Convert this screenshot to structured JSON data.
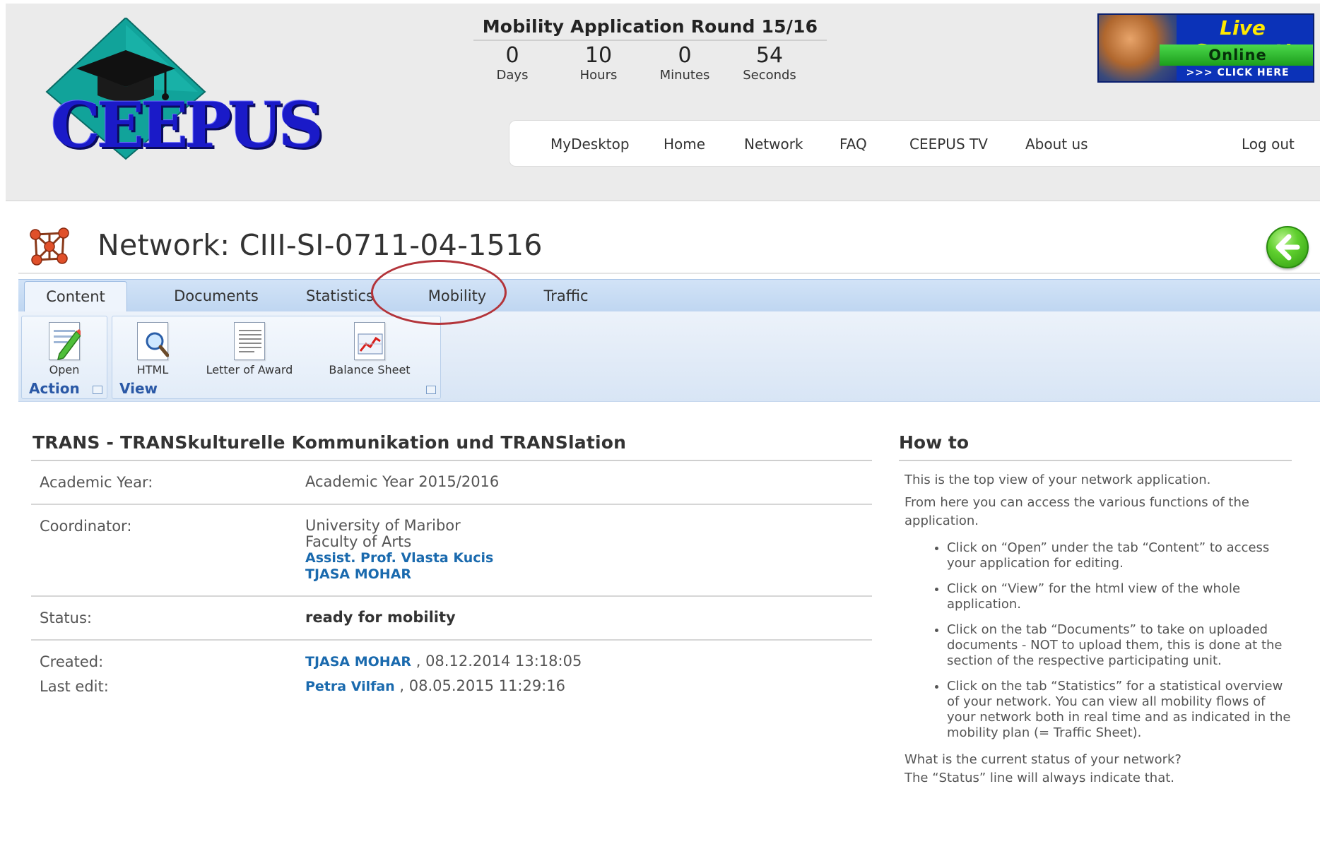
{
  "header": {
    "logo_text": "CEEPUS",
    "countdown": {
      "title": "Mobility Application Round 15/16",
      "units": [
        {
          "value": "0",
          "label": "Days"
        },
        {
          "value": "10",
          "label": "Hours"
        },
        {
          "value": "0",
          "label": "Minutes"
        },
        {
          "value": "54",
          "label": "Seconds"
        }
      ]
    },
    "live_support": {
      "title": "Live Support!",
      "status": "Online",
      "cta": ">>> CLICK HERE"
    },
    "nav": [
      "MyDesktop",
      "Home",
      "Network",
      "FAQ",
      "CEEPUS TV",
      "About us",
      "Log out"
    ]
  },
  "page": {
    "title": "Network: CIII-SI-0711-04-1516"
  },
  "ribbon": {
    "tabs": [
      "Content",
      "Documents",
      "Statistics",
      "Mobility",
      "Traffic"
    ],
    "active_tab": "Content",
    "groups": {
      "action": {
        "label": "Action",
        "buttons": [
          "Open"
        ]
      },
      "view": {
        "label": "View",
        "buttons": [
          "HTML",
          "Letter of Award",
          "Balance Sheet"
        ]
      }
    }
  },
  "details": {
    "heading": "TRANS - TRANSkulturelle Kommunikation und TRANSlation",
    "academic_year": {
      "label": "Academic Year:",
      "value": "Academic Year 2015/2016"
    },
    "coordinator": {
      "label": "Coordinator:",
      "university": "University of Maribor",
      "faculty": "Faculty of Arts",
      "person": "Assist. Prof. Vlasta Kucis",
      "contact": "TJASA MOHAR"
    },
    "status": {
      "label": "Status:",
      "value": "ready for mobility"
    },
    "created": {
      "label": "Created:",
      "user": "TJASA MOHAR",
      "date": " , 08.12.2014 13:18:05"
    },
    "last_edit": {
      "label": "Last edit:",
      "user": "Petra Vilfan",
      "date": " , 08.05.2015 11:29:16"
    }
  },
  "howto": {
    "title": "How to",
    "intro1": "This is the top view of your network application.",
    "intro2": "From here you can access the various functions of the application.",
    "items": [
      "Click on “Open” under the tab “Content” to access your application for editing.",
      "Click on “View” for the html view of the whole application.",
      "Click on the tab “Documents” to take on uploaded documents - NOT to upload them, this is done at the section of the respective participating unit.",
      "Click on the tab “Statistics” for a statistical overview of your network. You can view all mobility flows of your network both in real time and as indicated in the mobility plan (= Traffic Sheet)."
    ],
    "outro1": "What is the current status of your network?",
    "outro2": "The “Status” line will always indicate that."
  },
  "colors": {
    "link": "#1a6aae",
    "ribbon": "#bfd6f1",
    "highlight": "#b3343a",
    "live_support_yellow": "#ffe900"
  }
}
